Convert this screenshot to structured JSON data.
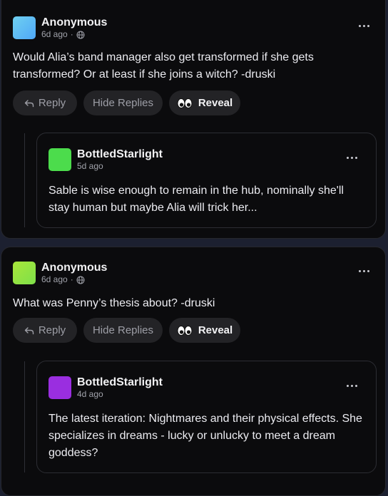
{
  "comments": [
    {
      "author": "Anonymous",
      "time": "6d ago",
      "avatar_color_from": "#6fd0f0",
      "avatar_color_to": "#4fa8f8",
      "text": "Would Alia’s band manager also get transformed if she gets transformed? Or at least if she joins a witch? -druski",
      "actions": {
        "reply": "Reply",
        "hide_replies": "Hide Replies",
        "reveal": "Reveal"
      },
      "reply": {
        "author": "BottledStarlight",
        "time": "5d ago",
        "avatar_color": "#4cdc4c",
        "text": "Sable is wise enough to remain in the hub, nominally she'll stay human but maybe Alia will trick her..."
      }
    },
    {
      "author": "Anonymous",
      "time": "6d ago",
      "avatar_color_from": "#a8e63a",
      "avatar_color_to": "#7ee04a",
      "text": "What was Penny’s thesis about? -druski",
      "actions": {
        "reply": "Reply",
        "hide_replies": "Hide Replies",
        "reveal": "Reveal"
      },
      "reply": {
        "author": "BottledStarlight",
        "time": "4d ago",
        "avatar_color": "#9a2ee0",
        "text": "The latest iteration: Nightmares and their physical effects. She specializes in dreams - lucky or unlucky to meet a dream goddess?"
      }
    }
  ],
  "icons": {
    "more": "more-options-icon",
    "globe": "globe-icon",
    "reply": "reply-arrow-icon",
    "reveal": "eyes-icon"
  }
}
